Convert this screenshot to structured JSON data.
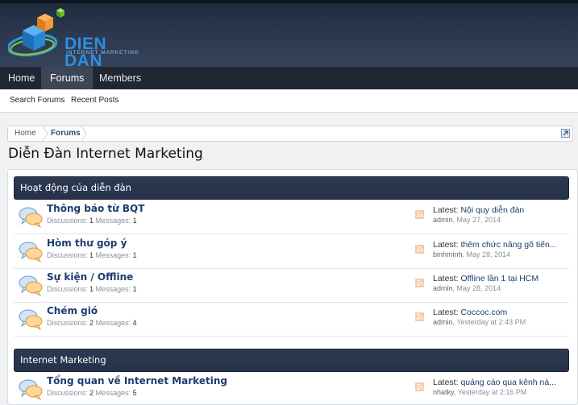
{
  "logo": {
    "title": "DIEN DAN",
    "subtitle": "INTERNET MARKETING"
  },
  "nav": {
    "items": [
      {
        "label": "Home"
      },
      {
        "label": "Forums"
      },
      {
        "label": "Members"
      }
    ],
    "active": "Forums"
  },
  "subnav": {
    "items": [
      {
        "label": "Search Forums"
      },
      {
        "label": "Recent Posts"
      }
    ]
  },
  "breadcrumb": {
    "items": [
      {
        "label": "Home"
      },
      {
        "label": "Forums"
      }
    ]
  },
  "page_title": "Diễn Đàn Internet Marketing",
  "categories": [
    {
      "title": "Hoạt động của diễn đàn",
      "forums": [
        {
          "title": "Thông báo từ BQT",
          "discussions_label": "Discussions:",
          "discussions": "1",
          "messages_label": "Messages:",
          "messages": "1",
          "latest_label": "Latest:",
          "latest_title": "Nội quy diễn đàn",
          "latest_user": "admin",
          "latest_date": "May 27, 2014"
        },
        {
          "title": "Hòm thư góp ý",
          "discussions_label": "Discussions:",
          "discussions": "1",
          "messages_label": "Messages:",
          "messages": "1",
          "latest_label": "Latest:",
          "latest_title": "thêm chức năng gõ tiến...",
          "latest_user": "binhminh",
          "latest_date": "May 28, 2014"
        },
        {
          "title": "Sự kiện / Offline",
          "discussions_label": "Discussions:",
          "discussions": "1",
          "messages_label": "Messages:",
          "messages": "1",
          "latest_label": "Latest:",
          "latest_title": "Offline lần 1 tại HCM",
          "latest_user": "admin",
          "latest_date": "May 28, 2014"
        },
        {
          "title": "Chém gió",
          "discussions_label": "Discussions:",
          "discussions": "2",
          "messages_label": "Messages:",
          "messages": "4",
          "latest_label": "Latest:",
          "latest_title": "Coccoc.com",
          "latest_user": "admin",
          "latest_date": "Yesterday at 2:43 PM"
        }
      ]
    },
    {
      "title": "Internet Marketing",
      "forums": [
        {
          "title": "Tổng quan về Internet Marketing",
          "discussions_label": "Discussions:",
          "discussions": "2",
          "messages_label": "Messages:",
          "messages": "5",
          "latest_label": "Latest:",
          "latest_title": "quảng cáo qua kênh nà...",
          "latest_user": "nhatky",
          "latest_date": "Yesterday at 2:16 PM"
        }
      ]
    }
  ],
  "icons": {
    "forum": "speech-bubbles-icon",
    "rss": "rss-feed-icon",
    "popup": "popup-external-icon"
  },
  "colors": {
    "header_bg": "#2c3950",
    "nav_bg": "#202733",
    "category_bg": "#2e3a52",
    "link": "#1c3d70",
    "logo_blue": "#2e8fe0",
    "rss": "#f5a05a"
  }
}
